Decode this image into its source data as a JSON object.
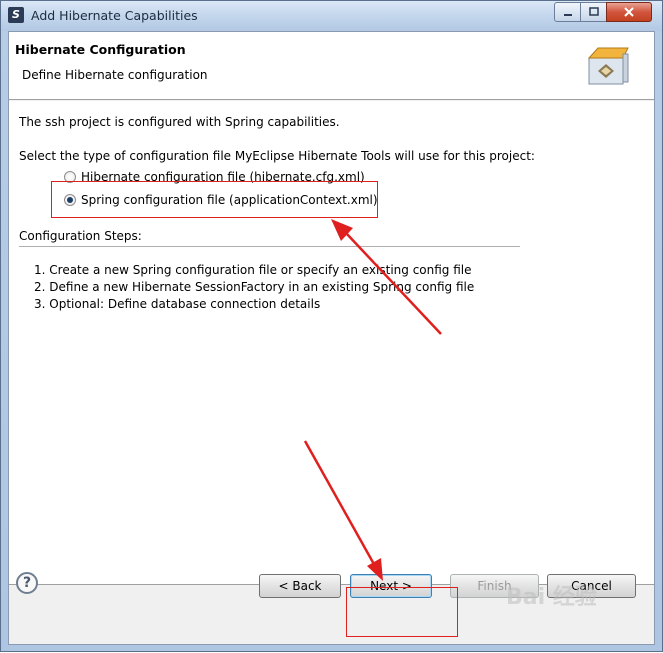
{
  "window": {
    "title": "Add Hibernate Capabilities"
  },
  "header": {
    "title": "Hibernate Configuration",
    "subtitle": "Define Hibernate configuration",
    "icon": "wizard-box-icon"
  },
  "body": {
    "intro": "The ssh project is configured with Spring capabilities.",
    "select_prompt": "Select the type of configuration file MyEclipse Hibernate Tools will use for this project:",
    "options": [
      {
        "label": "Hibernate configuration file (hibernate.cfg.xml)",
        "checked": false
      },
      {
        "label": "Spring configuration file (applicationContext.xml)",
        "checked": true
      }
    ],
    "steps_title": "Configuration Steps:",
    "steps": [
      "1. Create a new Spring configuration file or specify an existing config file",
      "2. Define a new Hibernate SessionFactory in an existing Spring config file",
      "3. Optional: Define database connection details"
    ]
  },
  "footer": {
    "help_icon": "help-icon",
    "back_label": "< Back",
    "next_label": "Next >",
    "finish_label": "Finish",
    "cancel_label": "Cancel",
    "finish_enabled": false
  },
  "annotations": {
    "color": "#e0201f"
  },
  "watermark": "Bai 经验"
}
